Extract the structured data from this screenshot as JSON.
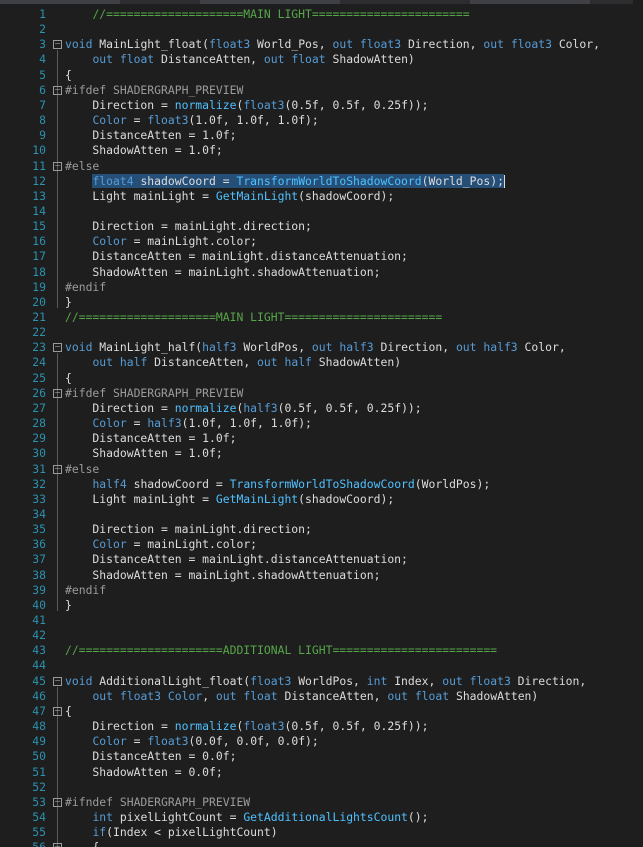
{
  "editor": {
    "language": "HLSL shader graph custom function",
    "selected_line": 12,
    "lines": [
      {
        "n": "1",
        "s": [
          [
            "    ",
            "pl"
          ],
          [
            "//====================MAIN LIGHT=======================",
            "cm"
          ]
        ]
      },
      {
        "n": "2",
        "s": []
      },
      {
        "n": "3",
        "fold": "-",
        "s": [
          [
            "void ",
            "kw"
          ],
          [
            "MainLight_float(",
            "pl"
          ],
          [
            "float3 ",
            "kw"
          ],
          [
            "World_Pos, ",
            "pl"
          ],
          [
            "out ",
            "kw"
          ],
          [
            "float3 ",
            "kw"
          ],
          [
            "Direction, ",
            "pl"
          ],
          [
            "out ",
            "kw"
          ],
          [
            "float3 ",
            "kw"
          ],
          [
            "Color,",
            "pl"
          ]
        ]
      },
      {
        "n": "4",
        "s": [
          [
            "    ",
            "pl"
          ],
          [
            "out ",
            "kw"
          ],
          [
            "float ",
            "kw"
          ],
          [
            "DistanceAtten, ",
            "pl"
          ],
          [
            "out ",
            "kw"
          ],
          [
            "float ",
            "kw"
          ],
          [
            "ShadowAtten)",
            "pl"
          ]
        ]
      },
      {
        "n": "5",
        "s": [
          [
            "{",
            "pl"
          ]
        ]
      },
      {
        "n": "6",
        "fold": "-",
        "s": [
          [
            "#ifdef SHADERGRAPH_PREVIEW",
            "pp"
          ]
        ]
      },
      {
        "n": "7",
        "s": [
          [
            "    Direction = ",
            "pl"
          ],
          [
            "normalize",
            "fn"
          ],
          [
            "(",
            "pl"
          ],
          [
            "float3",
            "kw"
          ],
          [
            "(0.5f, 0.5f, 0.25f));",
            "pl"
          ]
        ]
      },
      {
        "n": "8",
        "s": [
          [
            "    ",
            "pl"
          ],
          [
            "Color",
            "kw"
          ],
          [
            " = ",
            "pl"
          ],
          [
            "float3",
            "kw"
          ],
          [
            "(1.0f, 1.0f, 1.0f);",
            "pl"
          ]
        ]
      },
      {
        "n": "9",
        "s": [
          [
            "    DistanceAtten = 1.0f;",
            "pl"
          ]
        ]
      },
      {
        "n": "10",
        "s": [
          [
            "    ShadowAtten = 1.0f;",
            "pl"
          ]
        ]
      },
      {
        "n": "11",
        "fold": "-",
        "s": [
          [
            "#else",
            "pp"
          ]
        ]
      },
      {
        "n": "12",
        "s": [
          [
            "    ",
            "pl"
          ],
          [
            "float4 ",
            "kw"
          ],
          [
            "shadowCoord = ",
            "pl"
          ],
          [
            "TransformWorldToShadowCoord",
            "fn"
          ],
          [
            "(World_Pos);",
            "pl"
          ]
        ]
      },
      {
        "n": "13",
        "s": [
          [
            "    Light mainLight = ",
            "pl"
          ],
          [
            "GetMainLight",
            "fn"
          ],
          [
            "(shadowCoord);",
            "pl"
          ]
        ]
      },
      {
        "n": "14",
        "s": []
      },
      {
        "n": "15",
        "s": [
          [
            "    Direction = mainLight.direction;",
            "pl"
          ]
        ]
      },
      {
        "n": "16",
        "s": [
          [
            "    ",
            "pl"
          ],
          [
            "Color",
            "kw"
          ],
          [
            " = mainLight.color;",
            "pl"
          ]
        ]
      },
      {
        "n": "17",
        "s": [
          [
            "    DistanceAtten = mainLight.distanceAttenuation;",
            "pl"
          ]
        ]
      },
      {
        "n": "18",
        "s": [
          [
            "    ShadowAtten = mainLight.shadowAttenuation;",
            "pl"
          ]
        ]
      },
      {
        "n": "19",
        "s": [
          [
            "#endif",
            "pp"
          ]
        ]
      },
      {
        "n": "20",
        "s": [
          [
            "}",
            "pl"
          ]
        ]
      },
      {
        "n": "21",
        "s": [
          [
            "//====================MAIN LIGHT=======================",
            "cm"
          ]
        ]
      },
      {
        "n": "22",
        "s": []
      },
      {
        "n": "23",
        "fold": "-",
        "s": [
          [
            "void ",
            "kw"
          ],
          [
            "MainLight_half(",
            "pl"
          ],
          [
            "half3 ",
            "kw"
          ],
          [
            "WorldPos, ",
            "pl"
          ],
          [
            "out ",
            "kw"
          ],
          [
            "half3 ",
            "kw"
          ],
          [
            "Direction, ",
            "pl"
          ],
          [
            "out ",
            "kw"
          ],
          [
            "half3 ",
            "kw"
          ],
          [
            "Color,",
            "pl"
          ]
        ]
      },
      {
        "n": "24",
        "s": [
          [
            "    ",
            "pl"
          ],
          [
            "out ",
            "kw"
          ],
          [
            "half ",
            "kw"
          ],
          [
            "DistanceAtten, ",
            "pl"
          ],
          [
            "out ",
            "kw"
          ],
          [
            "half ",
            "kw"
          ],
          [
            "ShadowAtten)",
            "pl"
          ]
        ]
      },
      {
        "n": "25",
        "s": [
          [
            "{",
            "pl"
          ]
        ]
      },
      {
        "n": "26",
        "fold": "-",
        "s": [
          [
            "#ifdef SHADERGRAPH_PREVIEW",
            "pp"
          ]
        ]
      },
      {
        "n": "27",
        "s": [
          [
            "    Direction = ",
            "pl"
          ],
          [
            "normalize",
            "fn"
          ],
          [
            "(",
            "pl"
          ],
          [
            "half3",
            "kw"
          ],
          [
            "(0.5f, 0.5f, 0.25f));",
            "pl"
          ]
        ]
      },
      {
        "n": "28",
        "s": [
          [
            "    ",
            "pl"
          ],
          [
            "Color",
            "kw"
          ],
          [
            " = ",
            "pl"
          ],
          [
            "half3",
            "kw"
          ],
          [
            "(1.0f, 1.0f, 1.0f);",
            "pl"
          ]
        ]
      },
      {
        "n": "29",
        "s": [
          [
            "    DistanceAtten = 1.0f;",
            "pl"
          ]
        ]
      },
      {
        "n": "30",
        "s": [
          [
            "    ShadowAtten = 1.0f;",
            "pl"
          ]
        ]
      },
      {
        "n": "31",
        "fold": "-",
        "s": [
          [
            "#else",
            "pp"
          ]
        ]
      },
      {
        "n": "32",
        "s": [
          [
            "    ",
            "pl"
          ],
          [
            "half4 ",
            "kw"
          ],
          [
            "shadowCoord = ",
            "pl"
          ],
          [
            "TransformWorldToShadowCoord",
            "fn"
          ],
          [
            "(WorldPos);",
            "pl"
          ]
        ]
      },
      {
        "n": "33",
        "s": [
          [
            "    Light mainLight = ",
            "pl"
          ],
          [
            "GetMainLight",
            "fn"
          ],
          [
            "(shadowCoord);",
            "pl"
          ]
        ]
      },
      {
        "n": "34",
        "s": []
      },
      {
        "n": "35",
        "s": [
          [
            "    Direction = mainLight.direction;",
            "pl"
          ]
        ]
      },
      {
        "n": "36",
        "s": [
          [
            "    ",
            "pl"
          ],
          [
            "Color",
            "kw"
          ],
          [
            " = mainLight.color;",
            "pl"
          ]
        ]
      },
      {
        "n": "37",
        "s": [
          [
            "    DistanceAtten = mainLight.distanceAttenuation;",
            "pl"
          ]
        ]
      },
      {
        "n": "38",
        "s": [
          [
            "    ShadowAtten = mainLight.shadowAttenuation;",
            "pl"
          ]
        ]
      },
      {
        "n": "39",
        "s": [
          [
            "#endif",
            "pp"
          ]
        ]
      },
      {
        "n": "40",
        "s": [
          [
            "}",
            "pl"
          ]
        ]
      },
      {
        "n": "41",
        "s": []
      },
      {
        "n": "42",
        "s": []
      },
      {
        "n": "43",
        "s": [
          [
            "//=====================ADDITIONAL LIGHT========================",
            "cm"
          ]
        ]
      },
      {
        "n": "44",
        "s": []
      },
      {
        "n": "45",
        "fold": "-",
        "s": [
          [
            "void ",
            "kw"
          ],
          [
            "AdditionalLight_float(",
            "pl"
          ],
          [
            "float3 ",
            "kw"
          ],
          [
            "WorldPos, ",
            "pl"
          ],
          [
            "int ",
            "kw"
          ],
          [
            "Index, ",
            "pl"
          ],
          [
            "out ",
            "kw"
          ],
          [
            "float3 ",
            "kw"
          ],
          [
            "Direction,",
            "pl"
          ]
        ]
      },
      {
        "n": "46",
        "s": [
          [
            "    ",
            "pl"
          ],
          [
            "out ",
            "kw"
          ],
          [
            "float3 ",
            "kw"
          ],
          [
            "Color",
            "kw"
          ],
          [
            ", ",
            "pl"
          ],
          [
            "out ",
            "kw"
          ],
          [
            "float ",
            "kw"
          ],
          [
            "DistanceAtten, ",
            "pl"
          ],
          [
            "out ",
            "kw"
          ],
          [
            "float ",
            "kw"
          ],
          [
            "ShadowAtten)",
            "pl"
          ]
        ]
      },
      {
        "n": "47",
        "fold": "-",
        "s": [
          [
            "{",
            "pl"
          ]
        ]
      },
      {
        "n": "48",
        "s": [
          [
            "    Direction = ",
            "pl"
          ],
          [
            "normalize",
            "fn"
          ],
          [
            "(",
            "pl"
          ],
          [
            "float3",
            "kw"
          ],
          [
            "(0.5f, 0.5f, 0.25f));",
            "pl"
          ]
        ]
      },
      {
        "n": "49",
        "s": [
          [
            "    ",
            "pl"
          ],
          [
            "Color",
            "kw"
          ],
          [
            " = ",
            "pl"
          ],
          [
            "float3",
            "kw"
          ],
          [
            "(0.0f, 0.0f, 0.0f);",
            "pl"
          ]
        ]
      },
      {
        "n": "50",
        "s": [
          [
            "    DistanceAtten = 0.0f;",
            "pl"
          ]
        ]
      },
      {
        "n": "51",
        "s": [
          [
            "    ShadowAtten = 0.0f;",
            "pl"
          ]
        ]
      },
      {
        "n": "52",
        "s": []
      },
      {
        "n": "53",
        "fold": "-",
        "s": [
          [
            "#ifndef SHADERGRAPH_PREVIEW",
            "pp"
          ]
        ]
      },
      {
        "n": "54",
        "s": [
          [
            "    ",
            "pl"
          ],
          [
            "int ",
            "kw"
          ],
          [
            "pixelLightCount = ",
            "pl"
          ],
          [
            "GetAdditionalLightsCount",
            "fn"
          ],
          [
            "();",
            "pl"
          ]
        ]
      },
      {
        "n": "55",
        "s": [
          [
            "    ",
            "pl"
          ],
          [
            "if",
            "kw"
          ],
          [
            "(Index < pixelLightCount)",
            "pl"
          ]
        ]
      },
      {
        "n": "56",
        "fold": "-",
        "s": [
          [
            "    {",
            "pl"
          ]
        ]
      }
    ]
  }
}
